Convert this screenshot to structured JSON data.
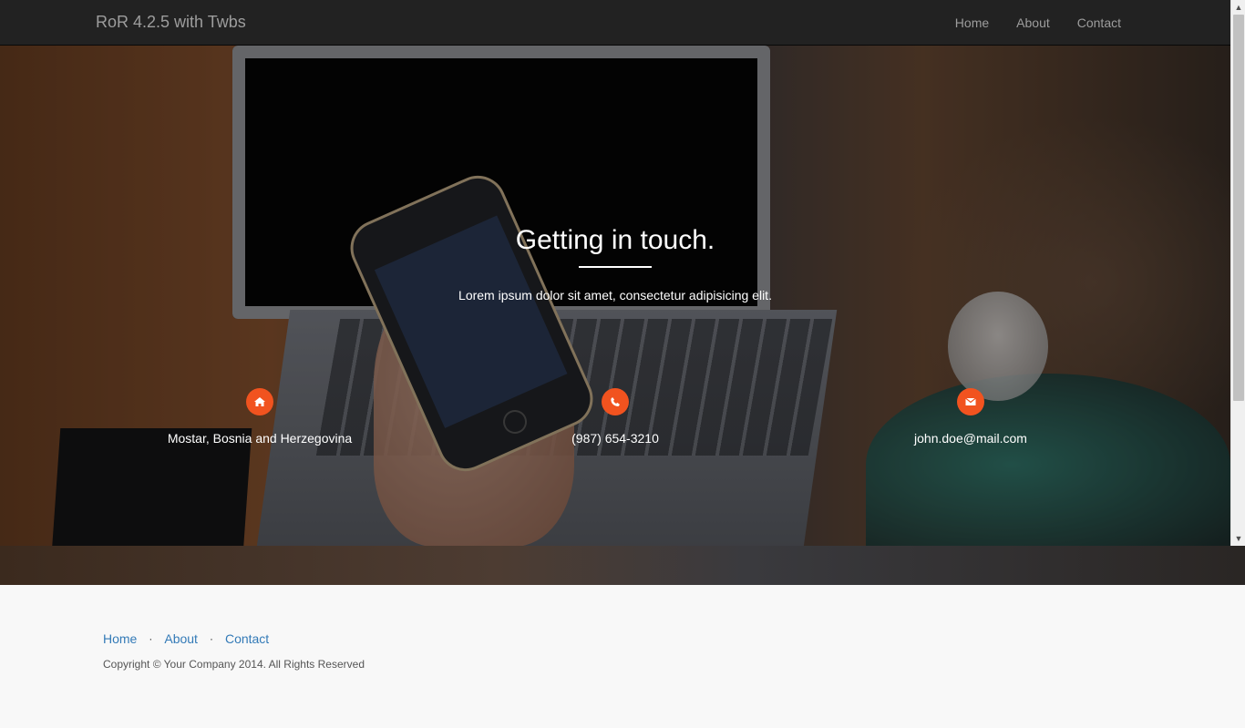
{
  "navbar": {
    "brand": "RoR 4.2.5 with Twbs",
    "links": [
      {
        "label": "Home"
      },
      {
        "label": "About"
      },
      {
        "label": "Contact"
      }
    ]
  },
  "hero": {
    "title": "Getting in touch.",
    "lead": "Lorem ipsum dolor sit amet, consectetur adipisicing elit.",
    "contacts": [
      {
        "icon": "home-icon",
        "text": "Mostar, Bosnia and Herzegovina"
      },
      {
        "icon": "phone-icon",
        "text": "(987) 654-3210"
      },
      {
        "icon": "envelope-icon",
        "text": "john.doe@mail.com"
      }
    ],
    "accent_color": "#f1531f"
  },
  "footer": {
    "links": [
      {
        "label": "Home"
      },
      {
        "label": "About"
      },
      {
        "label": "Contact"
      }
    ],
    "separator": "·",
    "copyright": "Copyright © Your Company 2014. All Rights Reserved"
  },
  "scrollbar": {
    "up_glyph": "▲",
    "down_glyph": "▼"
  }
}
